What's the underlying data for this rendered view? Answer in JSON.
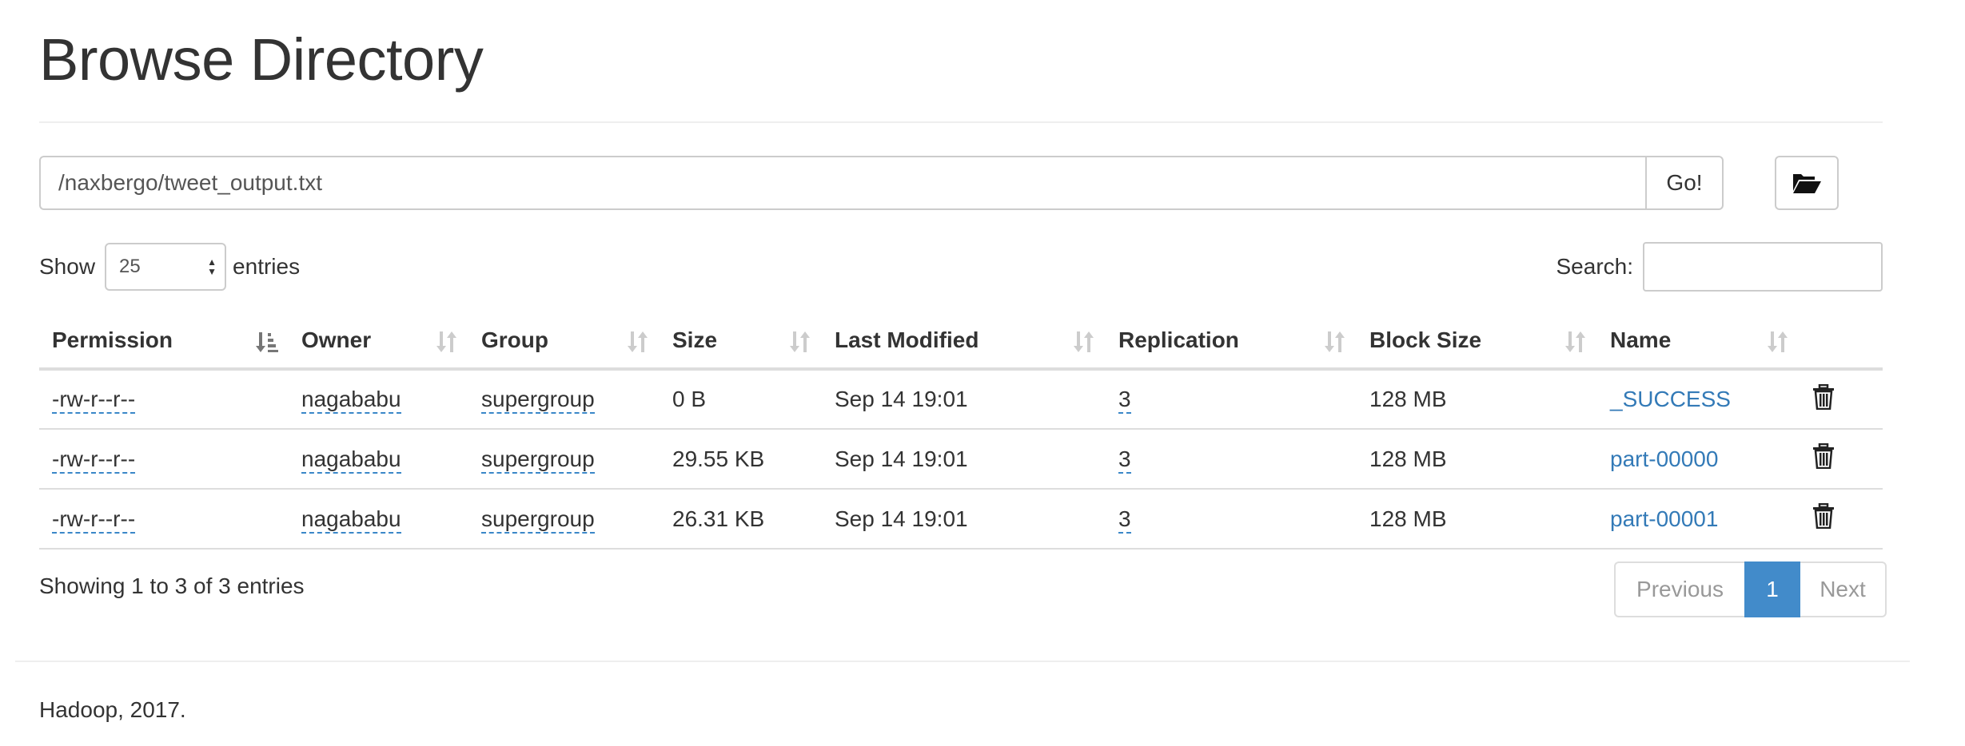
{
  "page": {
    "title": "Browse Directory",
    "footer": "Hadoop, 2017."
  },
  "path_bar": {
    "value": "/naxbergo/tweet_output.txt",
    "go_label": "Go!",
    "folder_icon": "folder-open-icon"
  },
  "length": {
    "show_label": "Show",
    "selected": "25",
    "entries_label": "entries"
  },
  "search": {
    "label": "Search:",
    "value": ""
  },
  "table": {
    "columns": [
      "Permission",
      "Owner",
      "Group",
      "Size",
      "Last Modified",
      "Replication",
      "Block Size",
      "Name"
    ],
    "sorted_column": "Permission",
    "sort_direction": "ascending",
    "rows": [
      {
        "permission": "-rw-r--r--",
        "owner": "nagababu",
        "group": "supergroup",
        "size": "0 B",
        "modified": "Sep 14 19:01",
        "replication": "3",
        "block_size": "128 MB",
        "name": "_SUCCESS"
      },
      {
        "permission": "-rw-r--r--",
        "owner": "nagababu",
        "group": "supergroup",
        "size": "29.55 KB",
        "modified": "Sep 14 19:01",
        "replication": "3",
        "block_size": "128 MB",
        "name": "part-00000"
      },
      {
        "permission": "-rw-r--r--",
        "owner": "nagababu",
        "group": "supergroup",
        "size": "26.31 KB",
        "modified": "Sep 14 19:01",
        "replication": "3",
        "block_size": "128 MB",
        "name": "part-00001"
      }
    ]
  },
  "info": "Showing 1 to 3 of 3 entries",
  "pagination": {
    "previous": "Previous",
    "current": "1",
    "next": "Next"
  },
  "colors": {
    "link": "#337ab7",
    "active_page": "#428bca",
    "border": "#dddddd",
    "text": "#333333"
  }
}
